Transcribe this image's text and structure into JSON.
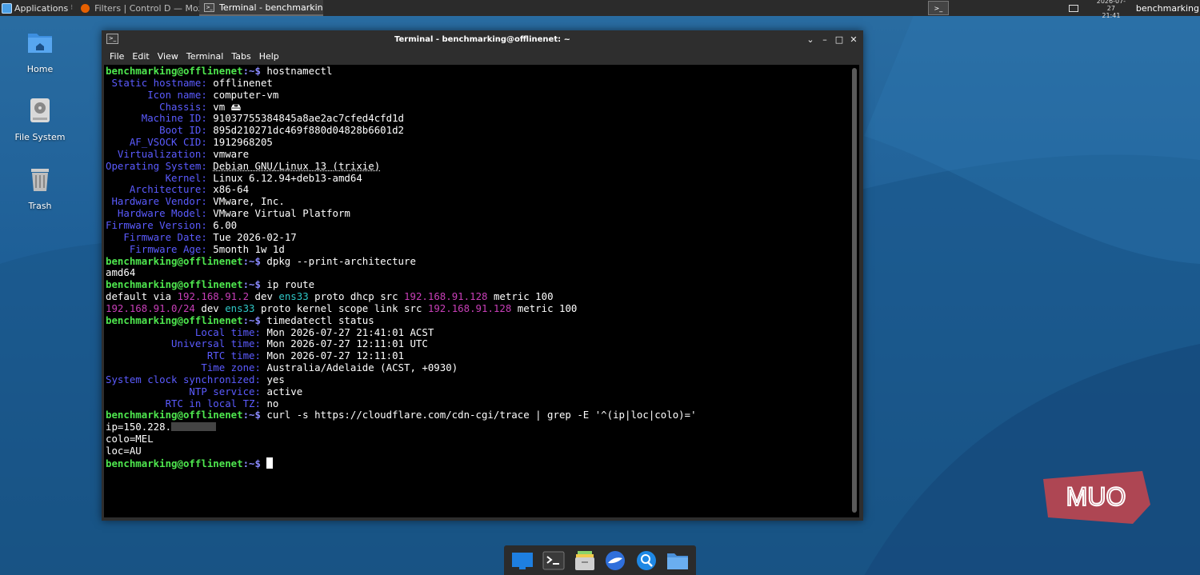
{
  "top_panel": {
    "applications_label": "Applications",
    "tasks": [
      {
        "label": "Filters | Control D — Mozi…",
        "icon": "firefox-icon",
        "active": false
      },
      {
        "label": "Terminal - benchmarking…",
        "icon": "terminal-icon",
        "active": true
      }
    ],
    "clock_date": "2026-07-27",
    "clock_time": "21:41",
    "user": "benchmarking"
  },
  "desktop_icons": [
    {
      "label": "Home",
      "icon": "home-folder-icon"
    },
    {
      "label": "File System",
      "icon": "hard-drive-icon"
    },
    {
      "label": "Trash",
      "icon": "trash-icon"
    }
  ],
  "window": {
    "title": "Terminal - benchmarking@offlinenet: ~",
    "menu": [
      "File",
      "Edit",
      "View",
      "Terminal",
      "Tabs",
      "Help"
    ]
  },
  "terminal": {
    "prompt_user": "benchmarking@offlinenet",
    "prompt_path": ":~$ ",
    "commands": [
      "hostnamectl",
      "dpkg --print-architecture",
      "ip route",
      "timedatectl status",
      "curl -s https://cloudflare.com/cdn-cgi/trace | grep -E '^(ip|loc|colo)='"
    ],
    "hostnamectl": [
      {
        "key": " Static hostname:",
        "value": "offlinenet"
      },
      {
        "key": "       Icon name:",
        "value": "computer-vm"
      },
      {
        "key": "         Chassis:",
        "value": "vm 🖴"
      },
      {
        "key": "      Machine ID:",
        "value": "91037755384845a8ae2ac7cfed4cfd1d"
      },
      {
        "key": "         Boot ID:",
        "value": "895d210271dc469f880d04828b6601d2"
      },
      {
        "key": "    AF_VSOCK CID:",
        "value": "1912968205"
      },
      {
        "key": "  Virtualization:",
        "value": "vmware"
      },
      {
        "key": "Operating System:",
        "value": "Debian GNU/Linux 13 (trixie)"
      },
      {
        "key": "          Kernel:",
        "value": "Linux 6.12.94+deb13-amd64"
      },
      {
        "key": "    Architecture:",
        "value": "x86-64"
      },
      {
        "key": " Hardware Vendor:",
        "value": "VMware, Inc."
      },
      {
        "key": "  Hardware Model:",
        "value": "VMware Virtual Platform"
      },
      {
        "key": "Firmware Version:",
        "value": "6.00"
      },
      {
        "key": "   Firmware Date:",
        "value": "Tue 2026-02-17"
      },
      {
        "key": "    Firmware Age:",
        "value": "5month 1w 1d"
      }
    ],
    "arch_output": "amd64",
    "route_lines": [
      {
        "a": "default via ",
        "ip1": "192.168.91.2",
        "b": " dev ",
        "dev": "ens33",
        "c": " proto dhcp src ",
        "ip2": "192.168.91.128",
        "d": " metric 100"
      },
      {
        "a": "",
        "ip1": "192.168.91.0/24",
        "b": " dev ",
        "dev": "ens33",
        "c": " proto kernel scope link src ",
        "ip2": "192.168.91.128",
        "d": " metric 100"
      }
    ],
    "timedatectl": [
      {
        "key": "               Local time:",
        "value": "Mon 2026-07-27 21:41:01 ACST"
      },
      {
        "key": "           Universal time:",
        "value": "Mon 2026-07-27 12:11:01 UTC"
      },
      {
        "key": "                 RTC time:",
        "value": "Mon 2026-07-27 12:11:01"
      },
      {
        "key": "                Time zone:",
        "value": "Australia/Adelaide (ACST, +0930)"
      },
      {
        "key": "System clock synchronized:",
        "value": "yes"
      },
      {
        "key": "              NTP service:",
        "value": "active"
      },
      {
        "key": "          RTC in local TZ:",
        "value": "no"
      }
    ],
    "trace_ip_prefix": "ip=150.228.",
    "trace_colo": "colo=MEL",
    "trace_loc": "loc=AU"
  },
  "watermark": "MUO",
  "dock": [
    "show-desktop-icon",
    "terminal-icon",
    "file-manager-icon",
    "browser-icon",
    "app-finder-icon",
    "folder-icon"
  ]
}
